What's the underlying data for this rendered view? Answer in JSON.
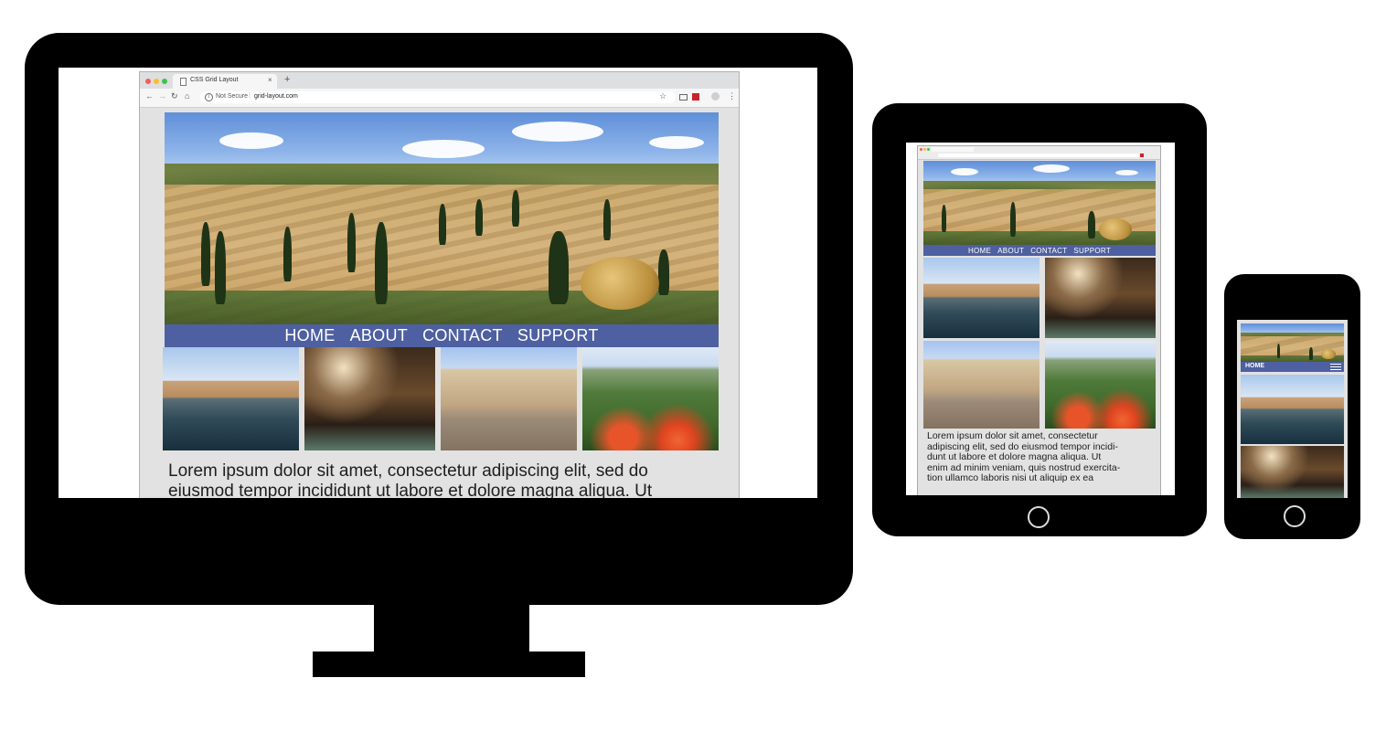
{
  "browser": {
    "tab_title": "CSS Grid Layout",
    "tab_close": "×",
    "new_tab": "+",
    "security_label": "Not Secure",
    "separator": "|",
    "url": "grid-layout.com"
  },
  "nav": {
    "items": [
      "HOME",
      "ABOUT",
      "CONTACT",
      "SUPPORT"
    ]
  },
  "desktop": {
    "lorem_line1": "Lorem ipsum dolor sit amet, consectetur adipiscing elit, sed do",
    "lorem_line2": "eiusmod tempor incididunt ut labore et dolore magna aliqua. Ut"
  },
  "tablet": {
    "lorem_lines": [
      "Lorem ipsum dolor sit amet, consectetur",
      "adipiscing elit, sed do eiusmod tempor incidi-",
      "dunt ut labore et dolore magna aliqua. Ut",
      "enim ad minim veniam, quis nostrud exercita-",
      "tion ullamco laboris nisi ut aliquip ex ea"
    ]
  },
  "phone": {
    "nav_label": "HOME"
  },
  "colors": {
    "nav": "#4e60a1",
    "device": "#000000",
    "page_bg": "#e2e2e2"
  }
}
